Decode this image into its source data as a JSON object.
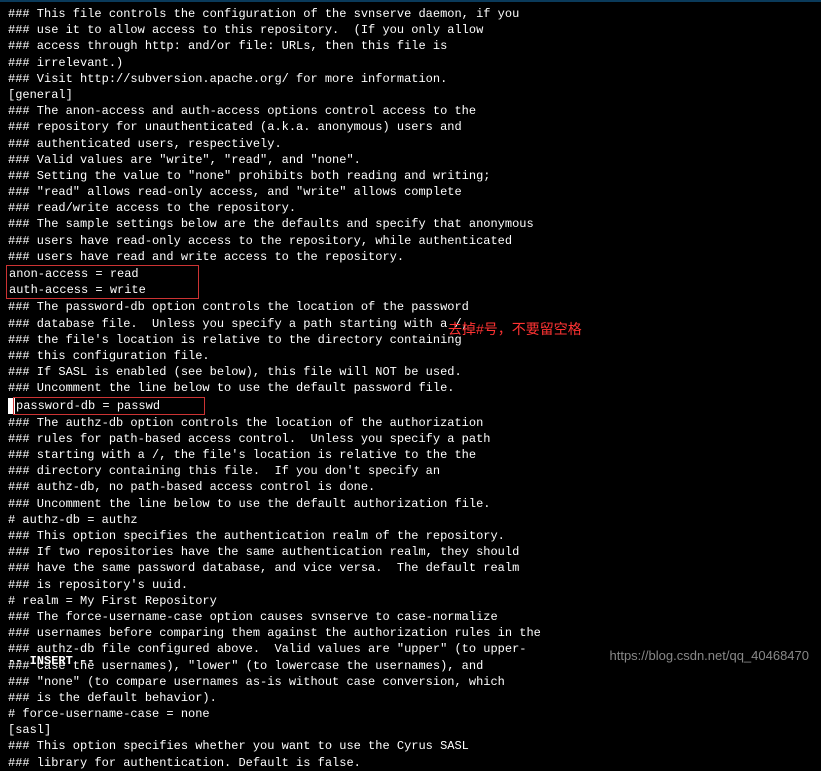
{
  "lines": {
    "l1": "### This file controls the configuration of the svnserve daemon, if you",
    "l2": "### use it to allow access to this repository.  (If you only allow",
    "l3": "### access through http: and/or file: URLs, then this file is",
    "l4": "### irrelevant.)",
    "l5": "",
    "l6": "### Visit http://subversion.apache.org/ for more information.",
    "l7": "",
    "l8": "[general]",
    "l9": "### The anon-access and auth-access options control access to the",
    "l10": "### repository for unauthenticated (a.k.a. anonymous) users and",
    "l11": "### authenticated users, respectively.",
    "l12": "### Valid values are \"write\", \"read\", and \"none\".",
    "l13": "### Setting the value to \"none\" prohibits both reading and writing;",
    "l14": "### \"read\" allows read-only access, and \"write\" allows complete",
    "l15": "### read/write access to the repository.",
    "l16": "### The sample settings below are the defaults and specify that anonymous",
    "l17": "### users have read-only access to the repository, while authenticated",
    "l18": "### users have read and write access to the repository.",
    "l19": "anon-access = read",
    "l20": "auth-access = write",
    "l21": "### The password-db option controls the location of the password",
    "l22": "### database file.  Unless you specify a path starting with a /,",
    "l23": "### the file's location is relative to the directory containing",
    "l24": "### this configuration file.",
    "l25": "### If SASL is enabled (see below), this file will NOT be used.",
    "l26": "### Uncomment the line below to use the default password file.",
    "l27": "password-db = passwd",
    "l28": "### The authz-db option controls the location of the authorization",
    "l29": "### rules for path-based access control.  Unless you specify a path",
    "l30": "### starting with a /, the file's location is relative to the the",
    "l31": "### directory containing this file.  If you don't specify an",
    "l32": "### authz-db, no path-based access control is done.",
    "l33": "### Uncomment the line below to use the default authorization file.",
    "l34": "# authz-db = authz",
    "l35": "### This option specifies the authentication realm of the repository.",
    "l36": "### If two repositories have the same authentication realm, they should",
    "l37": "### have the same password database, and vice versa.  The default realm",
    "l38": "### is repository's uuid.",
    "l39": "# realm = My First Repository",
    "l40": "### The force-username-case option causes svnserve to case-normalize",
    "l41": "### usernames before comparing them against the authorization rules in the",
    "l42": "### authz-db file configured above.  Valid values are \"upper\" (to upper-",
    "l43": "### case the usernames), \"lower\" (to lowercase the usernames), and",
    "l44": "### \"none\" (to compare usernames as-is without case conversion, which",
    "l45": "### is the default behavior).",
    "l46": "# force-username-case = none",
    "l47": "",
    "l48": "[sasl]",
    "l49": "### This option specifies whether you want to use the Cyrus SASL",
    "l50": "### library for authentication. Default is false."
  },
  "annotation": "去掉#号，不要留空格",
  "status": "-- INSERT --",
  "watermark": "https://blog.csdn.net/qq_40468470"
}
